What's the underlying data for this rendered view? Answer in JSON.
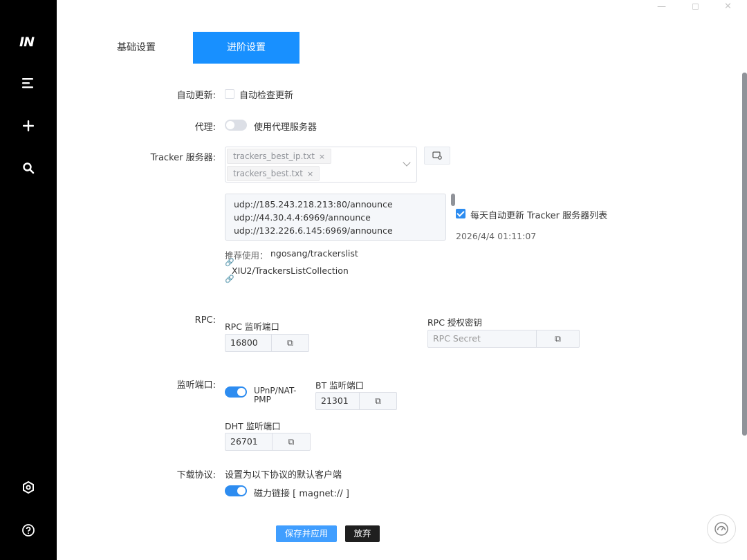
{
  "app": {
    "logo": "IN"
  },
  "sidebar": {
    "items": [
      {
        "icon": "menu-icon"
      },
      {
        "icon": "plus-icon"
      },
      {
        "icon": "search-icon"
      },
      {
        "icon": "settings-icon"
      },
      {
        "icon": "help-icon"
      }
    ]
  },
  "tabs": {
    "basic": "基础设置",
    "advanced": "进阶设置"
  },
  "auto_update": {
    "label": "自动更新:",
    "option": "自动检查更新",
    "checked": false
  },
  "proxy": {
    "label": "代理:",
    "option": "使用代理服务器",
    "enabled": false
  },
  "tracker": {
    "label": "Tracker 服务器:",
    "tags": [
      "trackers_best_ip.txt",
      "trackers_best.txt"
    ],
    "tag_close": "×",
    "list": [
      "udp://185.243.218.213:80/announce",
      "udp://44.30.4.4:6969/announce",
      "udp://132.226.6.145:6969/announce"
    ],
    "auto_update_option": "每天自动更新 Tracker 服务器列表",
    "auto_update_checked": true,
    "last_updated": "2026/4/4 01:11:07",
    "recommend_label": "推荐使用：",
    "recommend_links": [
      "ngosang/trackerslist",
      "XIU2/TrackersListCollection"
    ]
  },
  "rpc": {
    "label": "RPC:",
    "port_label": "RPC 监听端口",
    "port_value": "16800",
    "secret_label": "RPC 授权密钥",
    "secret_placeholder": "RPC Secret"
  },
  "listen": {
    "label": "监听端口:",
    "upnp_option": "UPnP/NAT-PMP",
    "upnp_enabled": true,
    "bt_label": "BT 监听端口",
    "bt_value": "21301",
    "dht_label": "DHT 监听端口",
    "dht_value": "26701"
  },
  "protocol": {
    "label": "下载协议:",
    "description": "设置为以下协议的默认客户端",
    "magnet_option": "磁力链接 [ magnet:// ]",
    "magnet_enabled": true
  },
  "actions": {
    "save": "保存并应用",
    "discard": "放弃"
  },
  "colors": {
    "primary": "#1890ff",
    "switch_on": "#2d8cf0",
    "sidebar": "#000000"
  }
}
